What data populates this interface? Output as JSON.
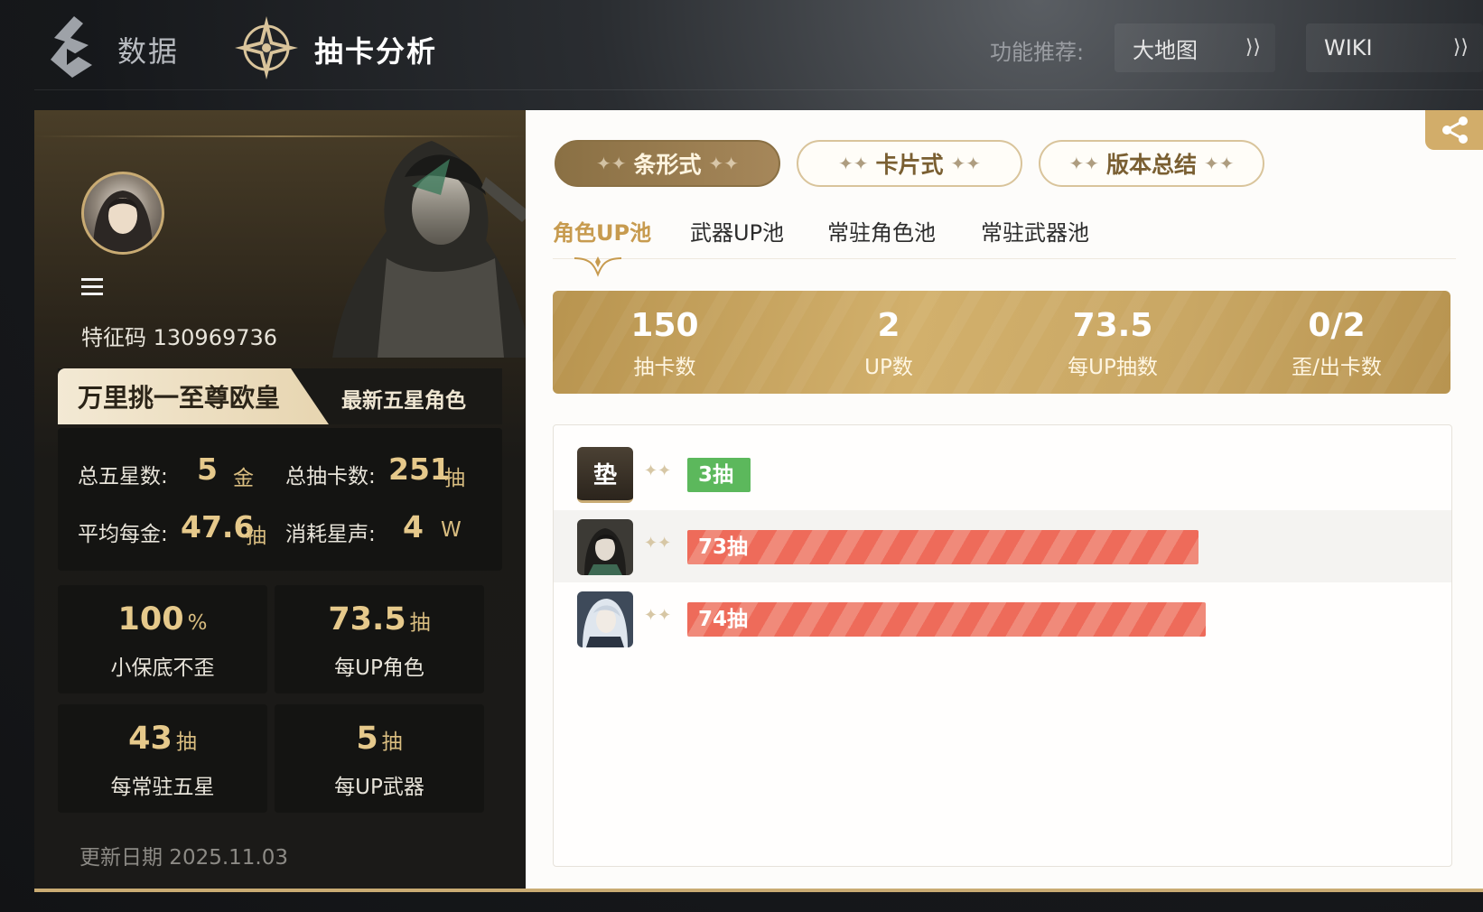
{
  "header": {
    "nav_data_label": "数据",
    "nav_title": "抽卡分析",
    "recommend_label": "功能推荐:",
    "recommend_links": [
      "大地图",
      "WIKI"
    ]
  },
  "profile": {
    "feature_code": "特征码 130969736",
    "title_tag": "万里挑一至尊欧皇",
    "latest_tab": "最新五星角色",
    "stats": {
      "total_five_star_label": "总五星数:",
      "total_five_star_value": "5",
      "total_five_star_unit": "金",
      "total_pulls_label": "总抽卡数:",
      "total_pulls_value": "251",
      "total_pulls_unit": "抽",
      "avg_per_gold_label": "平均每金:",
      "avg_per_gold_value": "47.6",
      "avg_per_gold_unit": "抽",
      "consumed_label": "消耗星声:",
      "consumed_value": "4",
      "consumed_unit": "W"
    },
    "tiles": [
      {
        "value": "100",
        "unit": "%",
        "label": "小保底不歪"
      },
      {
        "value": "73.5",
        "unit": "抽",
        "label": "每UP角色"
      },
      {
        "value": "43",
        "unit": "抽",
        "label": "每常驻五星"
      },
      {
        "value": "5",
        "unit": "抽",
        "label": "每UP武器"
      }
    ],
    "update_date": "更新日期 2025.11.03"
  },
  "view_tabs": [
    "条形式",
    "卡片式",
    "版本总结"
  ],
  "pool_tabs": [
    "角色UP池",
    "武器UP池",
    "常驻角色池",
    "常驻武器池"
  ],
  "summary": [
    {
      "value": "150",
      "label": "抽卡数"
    },
    {
      "value": "2",
      "label": "UP数"
    },
    {
      "value": "73.5",
      "label": "每UP抽数"
    },
    {
      "value": "0/2",
      "label": "歪/出卡数"
    }
  ],
  "records": [
    {
      "avatar_text": "垫",
      "label": "3抽",
      "pulls": 3
    },
    {
      "avatar_text": "",
      "label": "73抽",
      "pulls": 73
    },
    {
      "avatar_text": "",
      "label": "74抽",
      "pulls": 74
    }
  ],
  "colors": {
    "gold": "#c9ab73",
    "accent_text": "#e6c98b",
    "green_bar": "#5cb85c",
    "red_bar": "#ee6b5a"
  }
}
